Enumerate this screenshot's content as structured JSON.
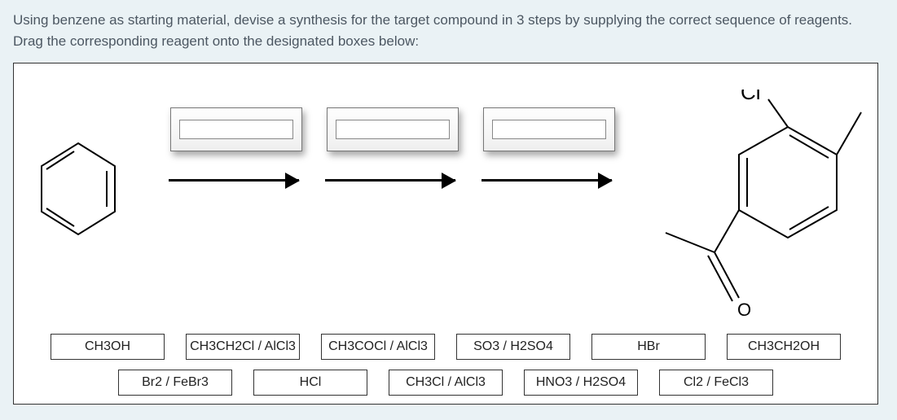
{
  "instructions": "Using benzene as starting material, devise a synthesis for the target compound in 3 steps by supplying the correct sequence of reagents. Drag the corresponding reagent onto the designated boxes below:",
  "product_label_cl": "Cl",
  "reagents_row1": [
    "CH3OH",
    "CH3CH2Cl / AlCl3",
    "CH3COCl / AlCl3",
    "SO3 / H2SO4",
    "HBr",
    "CH3CH2OH"
  ],
  "reagents_row2": [
    "Br2 / FeBr3",
    "HCl",
    "CH3Cl / AlCl3",
    "HNO3 / H2SO4",
    "Cl2 / FeCl3"
  ]
}
